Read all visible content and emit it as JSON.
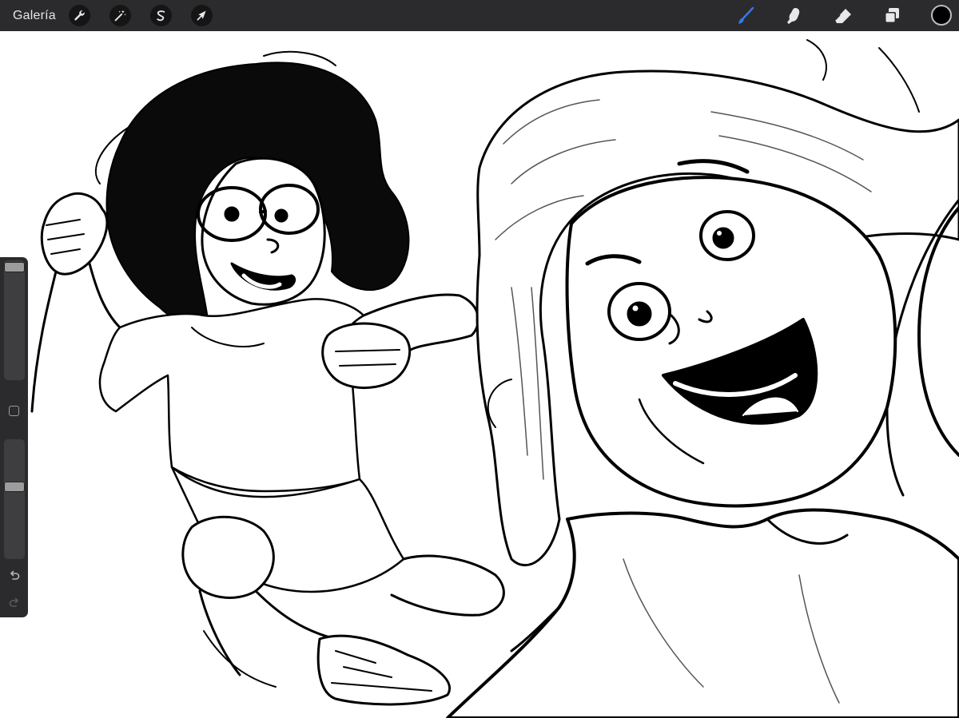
{
  "toolbar": {
    "gallery_label": "Galería",
    "left_tools": [
      {
        "name": "actions",
        "icon": "wrench-icon"
      },
      {
        "name": "adjustments",
        "icon": "magic-wand-icon"
      },
      {
        "name": "selection",
        "icon": "selection-s-icon"
      },
      {
        "name": "transform",
        "icon": "arrow-cursor-icon"
      }
    ],
    "right_tools": [
      {
        "name": "brush",
        "icon": "brush-icon",
        "active": true
      },
      {
        "name": "smudge",
        "icon": "smudge-finger-icon",
        "active": false
      },
      {
        "name": "eraser",
        "icon": "eraser-icon",
        "active": false
      },
      {
        "name": "layers",
        "icon": "layers-icon",
        "active": false
      }
    ],
    "current_color": "#000000",
    "active_color": "#2f7bf5",
    "inactive_color": "#e8e8e8"
  },
  "sidebar": {
    "brush_size_level": 1.0,
    "opacity_level": 0.62,
    "modify_button": "square-icon",
    "undo": "undo-icon",
    "redo": "redo-icon"
  },
  "canvas": {
    "background": "#ffffff",
    "ink": "#000000"
  }
}
